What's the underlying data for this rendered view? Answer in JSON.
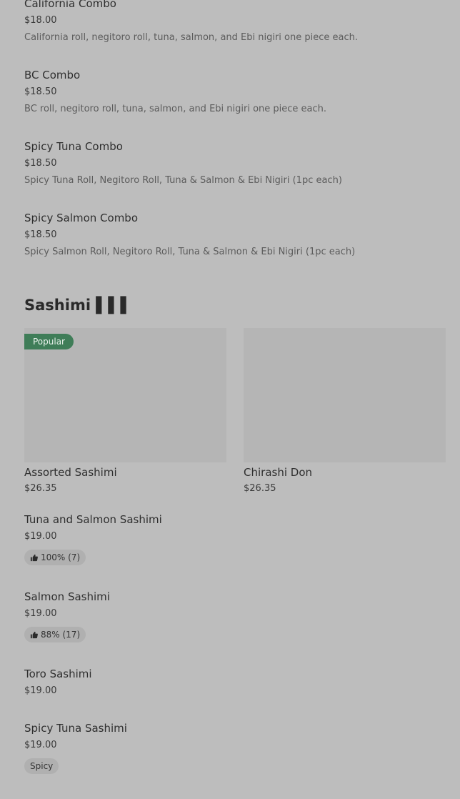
{
  "items_top": [
    {
      "name": "California Combo",
      "price": "$18.00",
      "desc": "California roll, negitoro roll, tuna, salmon, and Ebi nigiri one piece each."
    },
    {
      "name": "BC Combo",
      "price": "$18.50",
      "desc": "BC roll, negitoro roll, tuna, salmon, and Ebi nigiri one piece each."
    },
    {
      "name": "Spicy Tuna Combo",
      "price": "$18.50",
      "desc": "Spicy Tuna Roll, Negitoro Roll, Tuna & Salmon & Ebi Nigiri (1pc each)"
    },
    {
      "name": "Spicy Salmon Combo",
      "price": "$18.50",
      "desc": "Spicy Salmon Roll, Negitoro Roll, Tuna & Salmon & Ebi Nigiri (1pc each)"
    }
  ],
  "section": {
    "title": "Sashimi",
    "title_suffix": "▌▌▌"
  },
  "cards": [
    {
      "name": "Assorted Sashimi",
      "price": "$26.35",
      "badge": "Popular"
    },
    {
      "name": "Chirashi Don",
      "price": "$26.35"
    }
  ],
  "items_bottom": [
    {
      "name": "Tuna and Salmon Sashimi",
      "price": "$19.00",
      "rating": "100% (7)"
    },
    {
      "name": "Salmon Sashimi",
      "price": "$19.00",
      "rating": "88% (17)"
    },
    {
      "name": "Toro Sashimi",
      "price": "$19.00"
    },
    {
      "name": "Spicy Tuna Sashimi",
      "price": "$19.00",
      "tag": "Spicy"
    }
  ],
  "colors": {
    "background": "#bdbdbd",
    "badge": "#3f7d58",
    "image_placeholder": "#b5b5b5"
  }
}
